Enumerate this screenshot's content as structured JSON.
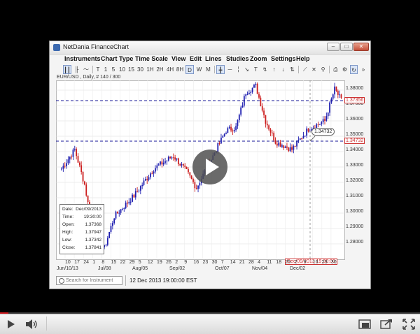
{
  "window": {
    "title": "NetDania FinanceChart",
    "min_label": "–",
    "max_label": "□",
    "close_label": "✕"
  },
  "menu": [
    "Instruments",
    "Chart Type",
    "Time Scale",
    "View",
    "Edit",
    "Lines",
    "Studies",
    "Zoom",
    "Settings",
    "Help"
  ],
  "toolbar": {
    "timescale_buttons": [
      "T",
      "1",
      "5",
      "10",
      "15",
      "30",
      "1H",
      "2H",
      "4H",
      "8H",
      "D",
      "W",
      "M"
    ],
    "selected_timescale": "D",
    "more_label": "»"
  },
  "chart": {
    "symbol_label": "EUR/USD , Daily, # 140 / 300",
    "price_labels": [
      "1.38000",
      "1.37000",
      "1.36000",
      "1.35000",
      "1.34000",
      "1.33000",
      "1.32000",
      "1.31000",
      "1.30000",
      "1.29000",
      "1.28000"
    ],
    "current_price_tag": "1.37356",
    "crosshair_price_tag": "1.34732",
    "callout_value": "1.34732",
    "crosshair_date": "Dec/09/2013 19:30:00",
    "date_ticks": [
      "10",
      "17",
      "24",
      "1",
      "8",
      "15",
      "22",
      "29",
      "5",
      "12",
      "19",
      "26",
      "2",
      "9",
      "16",
      "23",
      "30",
      "7",
      "14",
      "21",
      "28",
      "4",
      "11",
      "18",
      "25",
      "2",
      "9",
      "16",
      "23",
      "30"
    ],
    "month_labels": [
      "Jun/10/13",
      "Jul/08",
      "Aug/05",
      "Sep/02",
      "Oct/07",
      "Nov/04",
      "Dec/02"
    ],
    "colors": {
      "up": "#1f1fb0",
      "down": "#cc1f1f",
      "crosshair": "#1a1a99"
    }
  },
  "info": {
    "rows": [
      {
        "label": "Date:",
        "value": "Dec/09/2013"
      },
      {
        "label": "Time:",
        "value": "19:30:00"
      },
      {
        "label": "Open:",
        "value": "1.37368"
      },
      {
        "label": "High:",
        "value": "1.37947"
      },
      {
        "label": "Low:",
        "value": "1.37342"
      },
      {
        "label": "Close:",
        "value": "1.37841"
      }
    ]
  },
  "search": {
    "placeholder": "Search for Instrument"
  },
  "status": {
    "text": "12 Dec 2013 19:00:00 EST"
  },
  "player": {
    "progress": 0.02
  }
}
